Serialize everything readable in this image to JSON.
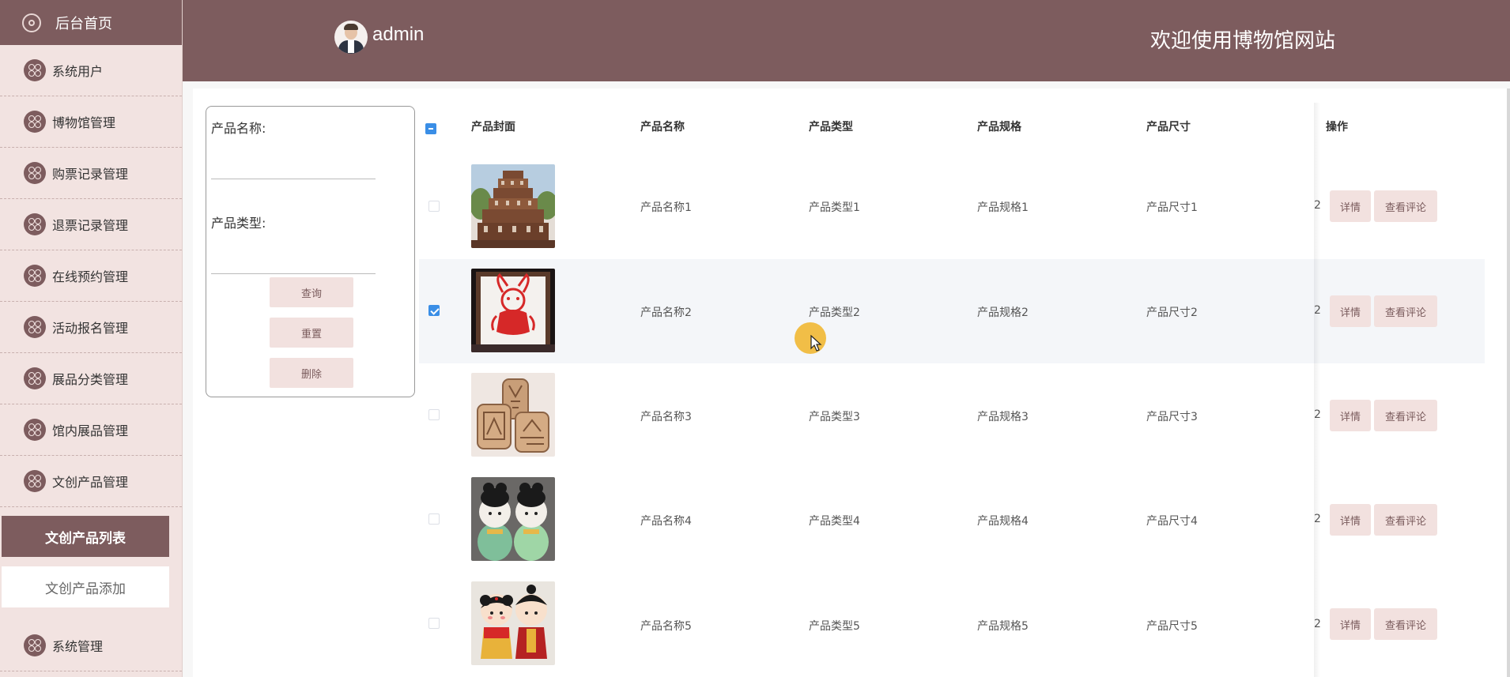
{
  "sidebar": {
    "home_label": "后台首页",
    "items": [
      {
        "label": "系统用户"
      },
      {
        "label": "博物馆管理"
      },
      {
        "label": "购票记录管理"
      },
      {
        "label": "退票记录管理"
      },
      {
        "label": "在线预约管理"
      },
      {
        "label": "活动报名管理"
      },
      {
        "label": "展品分类管理"
      },
      {
        "label": "馆内展品管理"
      },
      {
        "label": "文创产品管理"
      }
    ],
    "sub_items": [
      {
        "label": "文创产品列表",
        "active": true
      },
      {
        "label": "文创产品添加",
        "active": false
      }
    ],
    "last_item": {
      "label": "系统管理"
    }
  },
  "header": {
    "username": "admin",
    "welcome": "欢迎使用博物馆网站"
  },
  "search": {
    "name_label": "产品名称:",
    "type_label": "产品类型:",
    "query_button": "查询",
    "reset_button": "重置",
    "delete_button": "删除"
  },
  "table": {
    "columns": [
      "产品封面",
      "产品名称",
      "产品类型",
      "产品规格",
      "产品尺寸",
      "操作"
    ],
    "rows": [
      {
        "name": "产品名称1",
        "type": "产品类型1",
        "spec": "产品规格1",
        "size": "产品尺寸1",
        "clipped": "2",
        "checked": false,
        "image": "pagoda-model"
      },
      {
        "name": "产品名称2",
        "type": "产品类型2",
        "spec": "产品规格2",
        "size": "产品尺寸2",
        "clipped": "2",
        "checked": true,
        "image": "red-papercut-frame"
      },
      {
        "name": "产品名称3",
        "type": "产品类型3",
        "spec": "产品规格3",
        "size": "产品尺寸3",
        "clipped": "2",
        "checked": false,
        "image": "wooden-bookmarks"
      },
      {
        "name": "产品名称4",
        "type": "产品类型4",
        "spec": "产品规格4",
        "size": "产品尺寸4",
        "clipped": "2",
        "checked": false,
        "image": "figurine-pair"
      },
      {
        "name": "产品名称5",
        "type": "产品类型5",
        "spec": "产品规格5",
        "size": "产品尺寸5",
        "clipped": "2",
        "checked": false,
        "image": "doll-couple"
      }
    ],
    "detail_button": "详情",
    "comments_button": "查看评论"
  },
  "colors": {
    "brand": "#7d5c5e",
    "sidebar_bg": "#f2e3e1",
    "button_bg": "#f2e1df",
    "checkbox_blue": "#3a8ee6",
    "cursor_highlight": "#f0b428"
  }
}
